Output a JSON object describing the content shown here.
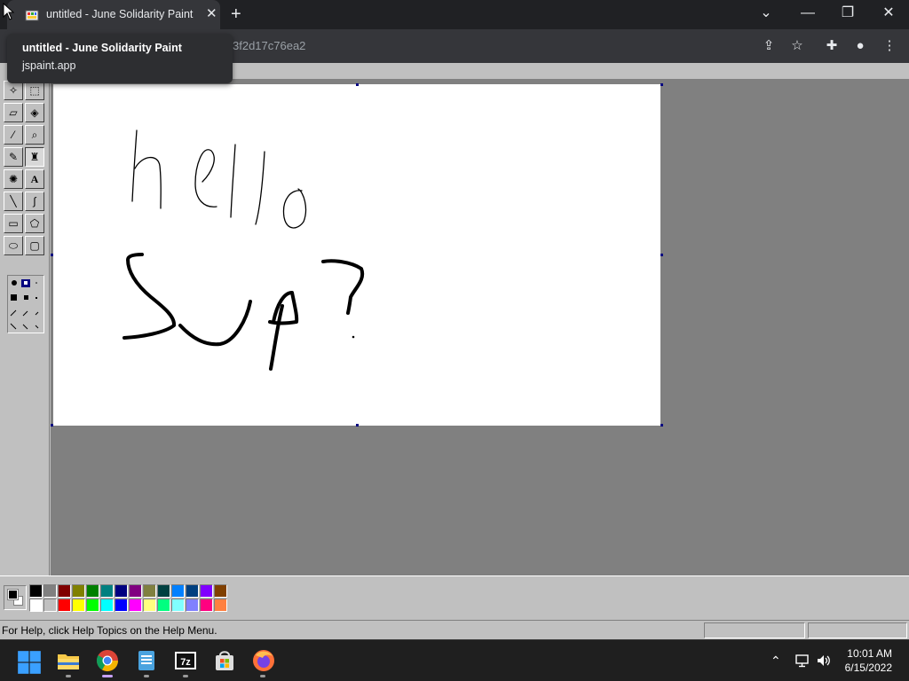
{
  "browser": {
    "tab_title": "untitled - June Solidarity Paint",
    "tab_close": "✕",
    "new_tab": "+",
    "url_fragment": "3f2d17c76ea2",
    "tooltip_title": "untitled - June Solidarity Paint",
    "tooltip_url": "jspaint.app",
    "window_controls": {
      "dropdown": "⌄",
      "minimize": "—",
      "maximize": "❐",
      "close": "✕"
    }
  },
  "paint": {
    "status_text": "For Help, click Help Topics on the Help Menu.",
    "primary_color": "#000000",
    "secondary_color": "#ffffff",
    "palette_top": [
      "#000000",
      "#808080",
      "#800000",
      "#808000",
      "#008000",
      "#008080",
      "#000080",
      "#800080",
      "#808040",
      "#004040",
      "#0080ff",
      "#004080",
      "#8000ff",
      "#804000"
    ],
    "palette_bottom": [
      "#ffffff",
      "#c0c0c0",
      "#ff0000",
      "#ffff00",
      "#00ff00",
      "#00ffff",
      "#0000ff",
      "#ff00ff",
      "#ffff80",
      "#00ff80",
      "#80ffff",
      "#8080ff",
      "#ff0080",
      "#ff8040"
    ],
    "canvas_text": [
      "hello",
      "Sup?"
    ]
  },
  "taskbar": {
    "time": "10:01 AM",
    "date": "6/15/2022"
  }
}
